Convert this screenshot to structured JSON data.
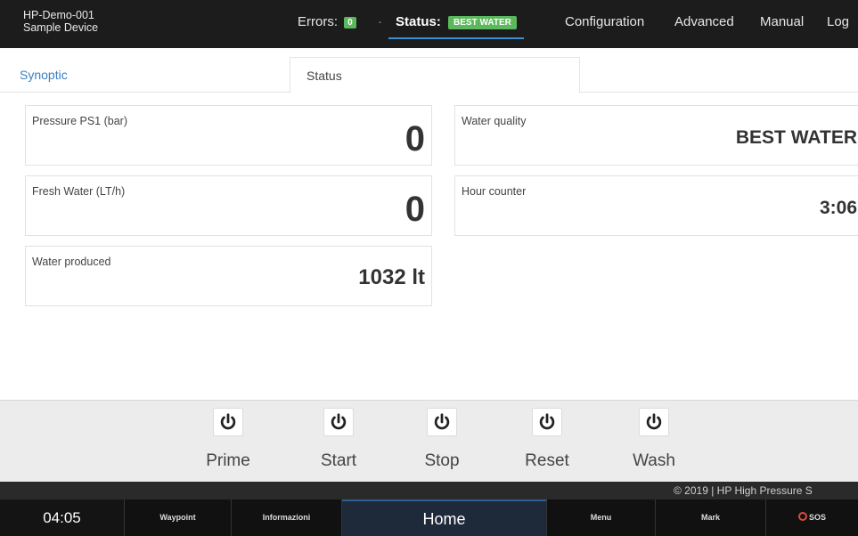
{
  "header": {
    "device_name": "HP-Demo-001",
    "device_sub": "Sample Device",
    "errors_label": "Errors:",
    "errors_count": "0",
    "separator": "·",
    "status_label": "Status:",
    "status_value": "BEST WATER",
    "nav": {
      "configuration": "Configuration",
      "advanced": "Advanced",
      "manual": "Manual",
      "log": "Log"
    }
  },
  "tabs": {
    "synoptic": "Synoptic",
    "status": "Status"
  },
  "cards": {
    "pressure": {
      "label": "Pressure PS1 (bar)",
      "value": "0"
    },
    "fresh_water": {
      "label": "Fresh Water (LT/h)",
      "value": "0"
    },
    "water_produced": {
      "label": "Water produced",
      "value": "1032 lt"
    },
    "water_quality": {
      "label": "Water quality",
      "value": "BEST WATER"
    },
    "hour_counter": {
      "label": "Hour counter",
      "value": "3:06"
    }
  },
  "controls": {
    "prime": "Prime",
    "start": "Start",
    "stop": "Stop",
    "reset": "Reset",
    "wash": "Wash"
  },
  "footer": {
    "copyright": "© 2019  |  HP High Pressure S"
  },
  "bottom_nav": {
    "clock": "04:05",
    "waypoint": "Waypoint",
    "informazioni": "Informazioni",
    "home": "Home",
    "menu": "Menu",
    "mark": "Mark",
    "sos": "SOS"
  },
  "colors": {
    "topbar_bg": "#1c1c1c",
    "status_badge": "#5cb85c",
    "active_tab_text": "#3a7fc1",
    "sos_icon": "#e04a3a"
  }
}
